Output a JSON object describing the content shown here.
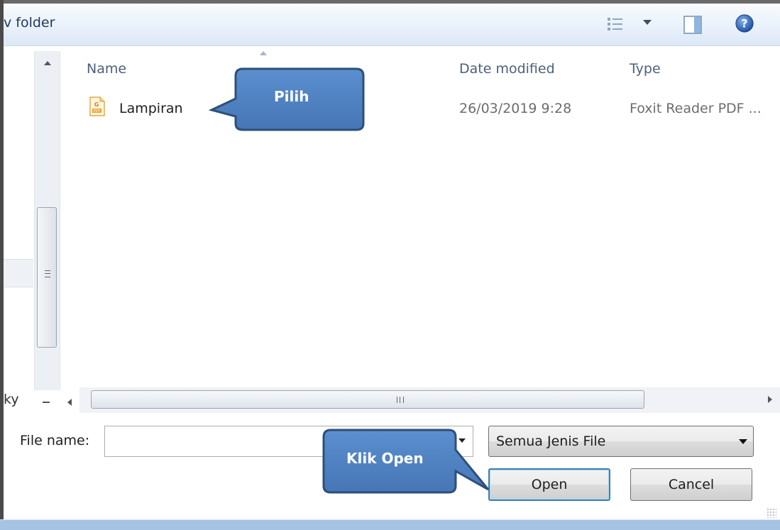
{
  "toolbar": {
    "new_folder_label": "v folder"
  },
  "columns": {
    "name": "Name",
    "date_modified": "Date modified",
    "type": "Type"
  },
  "files": [
    {
      "name": "Lampiran",
      "date": "26/03/2019 9:28",
      "type": "Foxit Reader PDF ..."
    }
  ],
  "nav": {
    "bottom_label": "ky"
  },
  "footer": {
    "filename_label": "File name:",
    "filename_value": "",
    "filetype_selected": "Semua Jenis File",
    "open_label": "Open",
    "cancel_label": "Cancel"
  },
  "callouts": {
    "pilih": "Pilih",
    "klik_open": "Klik Open"
  },
  "colors": {
    "callout_fill": "#4f81bd",
    "callout_border": "#2e4f7a",
    "bottom_strip": "#a7c3e3",
    "toolbar_bg": "#e9f1fb"
  },
  "icons": [
    "views-icon",
    "chevron-down-icon",
    "preview-pane-icon",
    "help-icon",
    "pdf-file-icon"
  ]
}
